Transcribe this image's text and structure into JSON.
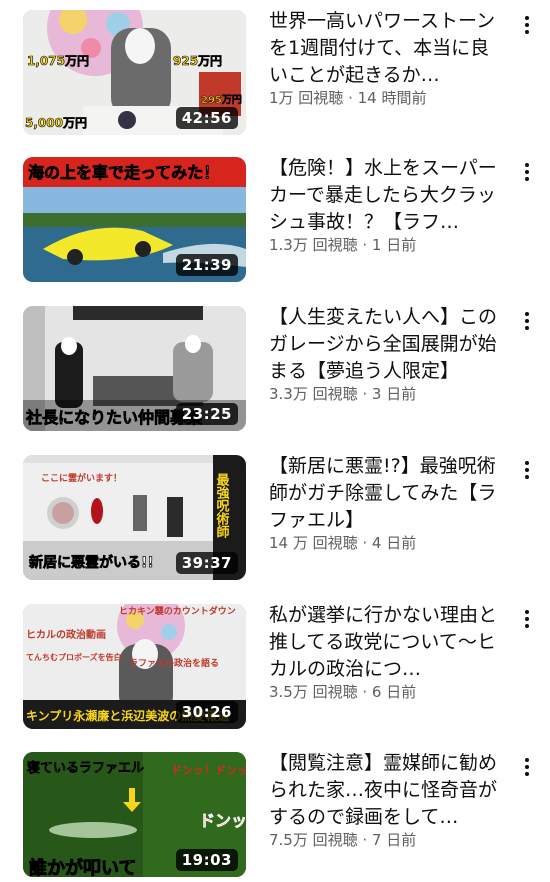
{
  "videos": [
    {
      "title": "世界一高いパワーストーンを1週間付けて、本当に良いことが起きるか…",
      "meta": "1万 回視聴 · 14 時間前",
      "duration": "42:56",
      "thumb_text": [
        "1,075万円",
        "925万円",
        "5,000万円",
        "295万円"
      ]
    },
    {
      "title": "【危険！】水上をスーパーカーで暴走したら大クラッシュ事故！？【ラフ…",
      "meta": "1.3万 回視聴 · 1 日前",
      "duration": "21:39",
      "thumb_text": [
        "海の上を車で走ってみた！"
      ]
    },
    {
      "title": "【人生変えたい人へ】このガレージから全国展開が始まる【夢追う人限定】",
      "meta": "3.3万 回視聴 · 3 日前",
      "duration": "23:25",
      "thumb_text": [
        "社長になりたい仲間募集"
      ]
    },
    {
      "title": "【新居に悪霊!?】最強呪術師がガチ除霊してみた【ラファエル】",
      "meta": "14 万 回視聴 · 4 日前",
      "duration": "39:37",
      "thumb_text": [
        "ここに霊がいます！",
        "最強呪術師",
        "新居に悪霊がいる!!"
      ]
    },
    {
      "title": "私が選挙に行かない理由と推してる政党について〜ヒカルの政治につ…",
      "meta": "3.5万 回視聴 · 6 日前",
      "duration": "30:26",
      "thumb_text": [
        "ヒカキン襲のカウントダウン",
        "ヒカルの政治動画",
        "てんちむプロポーズを告白",
        "ラファエル政治を語る",
        "キンプリ永瀬廉と浜辺美波の熱愛報道"
      ]
    },
    {
      "title": "【閲覧注意】霊媒師に勧められた家…夜中に怪奇音がするので録画をして…",
      "meta": "7.5万 回視聴 · 7 日前",
      "duration": "19:03",
      "thumb_text": [
        "寝ているラファエル",
        "ドンッ！ドンッ！",
        "ドンッ!!",
        "誰かが叩いて"
      ]
    }
  ],
  "colors": {
    "title_text": "#0f0f0f",
    "meta_text": "#606060",
    "background": "#ffffff",
    "duration_badge": "#000000"
  },
  "icons": {
    "more": "vertical-ellipsis-icon"
  }
}
